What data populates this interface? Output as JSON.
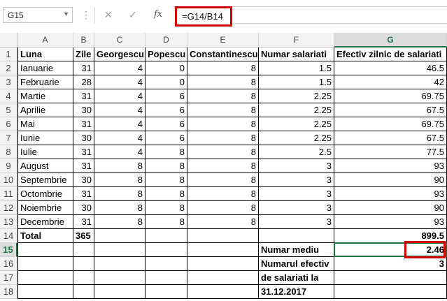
{
  "formula_bar": {
    "name_box": "G15",
    "cancel_glyph": "✕",
    "enter_glyph": "✓",
    "fx_label": "fx",
    "formula": "=G14/B14"
  },
  "columns": [
    "A",
    "B",
    "C",
    "D",
    "E",
    "F",
    "G"
  ],
  "rows": [
    "1",
    "2",
    "3",
    "4",
    "5",
    "6",
    "7",
    "8",
    "9",
    "10",
    "11",
    "12",
    "13",
    "14",
    "15",
    "16",
    "17",
    "18"
  ],
  "header_row": [
    "Luna",
    "Zile",
    "Georgescu",
    "Popescu",
    "Constantinescu",
    "Numar salariati",
    "Efectiv zilnic de salariati"
  ],
  "data_rows": [
    [
      "Ianuarie",
      "31",
      "4",
      "0",
      "8",
      "1.5",
      "46.5"
    ],
    [
      "Februarie",
      "28",
      "4",
      "0",
      "8",
      "1.5",
      "42"
    ],
    [
      "Martie",
      "31",
      "4",
      "6",
      "8",
      "2.25",
      "69.75"
    ],
    [
      "Aprilie",
      "30",
      "4",
      "6",
      "8",
      "2.25",
      "67.5"
    ],
    [
      "Mai",
      "31",
      "4",
      "6",
      "8",
      "2.25",
      "69.75"
    ],
    [
      "Iunie",
      "30",
      "4",
      "6",
      "8",
      "2.25",
      "67.5"
    ],
    [
      "Iulie",
      "31",
      "4",
      "8",
      "8",
      "2.5",
      "77.5"
    ],
    [
      "August",
      "31",
      "8",
      "8",
      "8",
      "3",
      "93"
    ],
    [
      "Septembrie",
      "30",
      "8",
      "8",
      "8",
      "3",
      "90"
    ],
    [
      "Octombrie",
      "31",
      "8",
      "8",
      "8",
      "3",
      "93"
    ],
    [
      "Noiembrie",
      "30",
      "8",
      "8",
      "8",
      "3",
      "90"
    ],
    [
      "Decembrie",
      "31",
      "8",
      "8",
      "8",
      "3",
      "93"
    ]
  ],
  "total_row": {
    "label": "Total",
    "days": "365",
    "sum": "899.5"
  },
  "summary": {
    "average_label": "Numar mediu",
    "average_value": "2.46",
    "effective_label_1": "Numarul efectiv",
    "effective_label_2": "de salariati la",
    "effective_label_3": "31.12.2017",
    "effective_value": "3"
  },
  "colors": {
    "selection": "#217346",
    "highlight": "#d20000"
  }
}
